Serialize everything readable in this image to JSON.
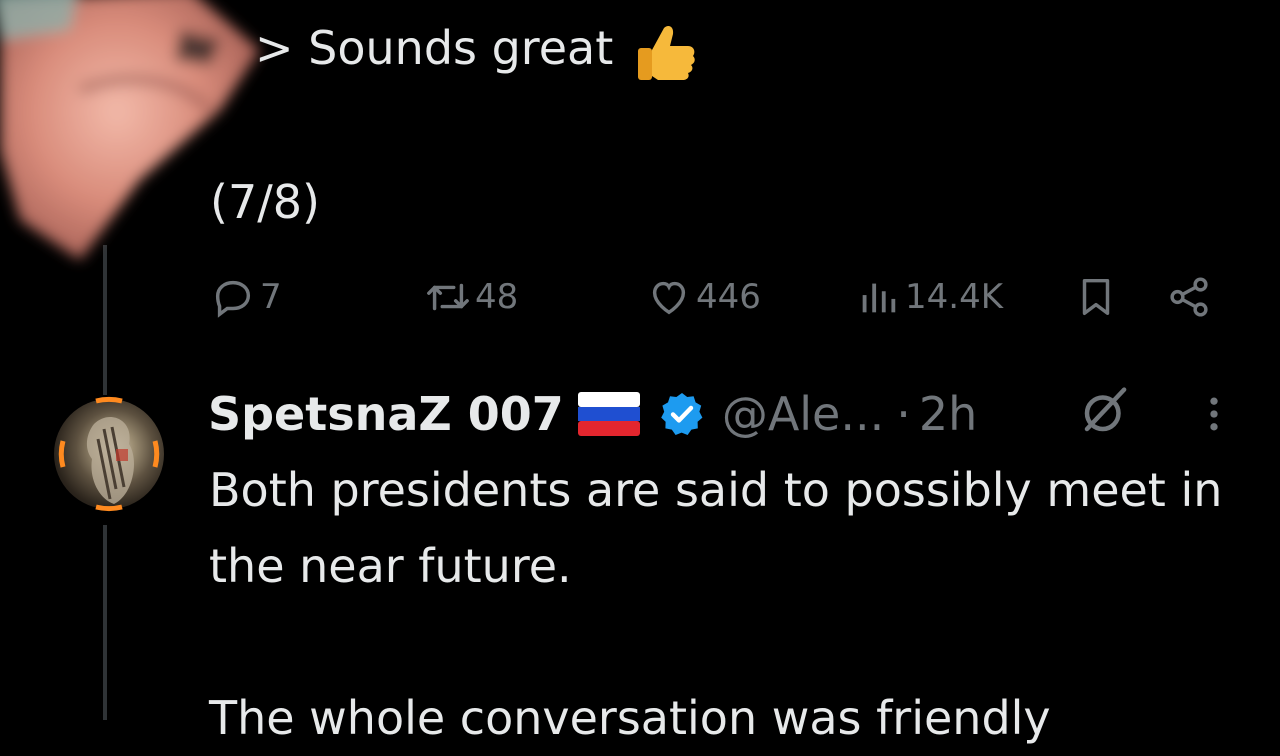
{
  "previous_tweet": {
    "quote_text": "> Sounds great",
    "counter": "(7/8)",
    "stats": {
      "replies": "7",
      "reposts": "48",
      "likes": "446",
      "views": "14.4K"
    }
  },
  "reply_tweet": {
    "display_name": "SpetsnaZ 007",
    "handle": "@Ale...",
    "separator": "·",
    "time": "2h",
    "body_paragraph_1": "Both presidents are said to possibly meet in the near future.",
    "body_paragraph_2": "The whole conversation was friendly"
  },
  "icons": {
    "reply": "reply-icon",
    "repost": "repost-icon",
    "like": "like-icon",
    "views": "views-icon",
    "bookmark": "bookmark-icon",
    "share": "share-icon",
    "verified": "verified-badge-icon",
    "flag": "russia-flag-icon",
    "grok": "grok-icon",
    "more": "more-vertical-icon"
  },
  "colors": {
    "background": "#000000",
    "text": "#e7e9ea",
    "muted": "#71767b",
    "verified": "#1d9bf0",
    "avatar_ring": "#ff8a1f"
  }
}
